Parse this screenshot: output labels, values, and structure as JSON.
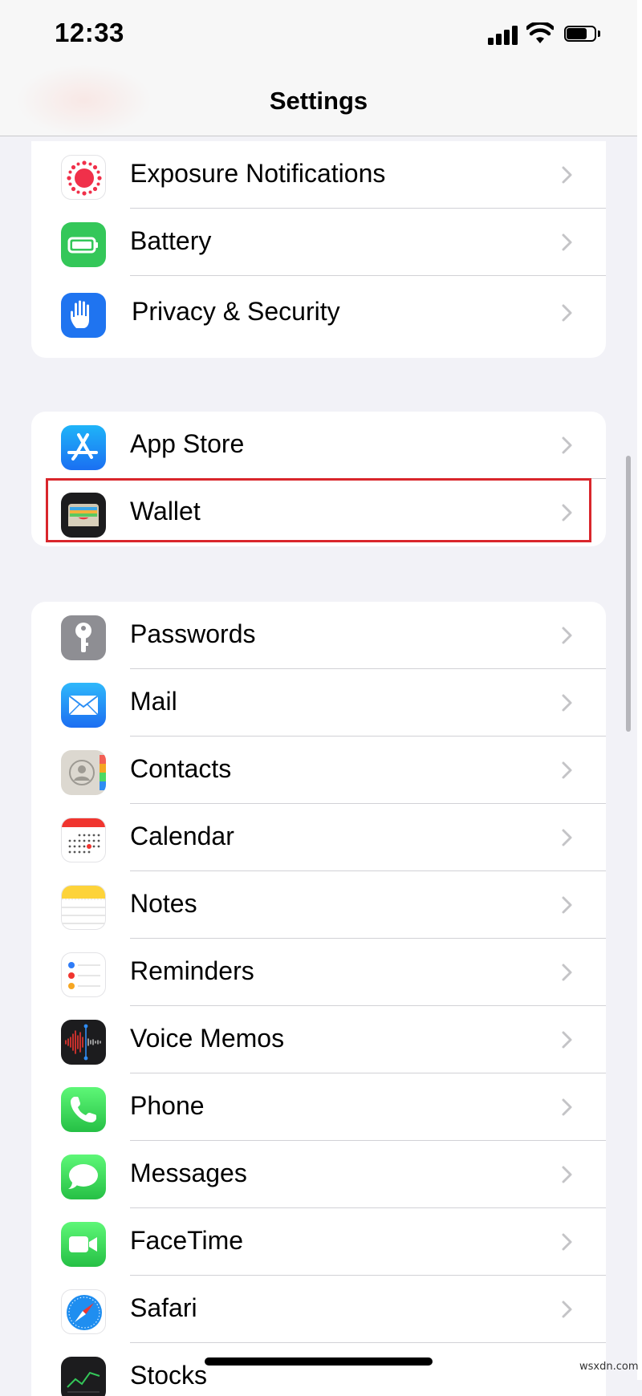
{
  "status_bar": {
    "time": "12:33"
  },
  "nav": {
    "title": "Settings"
  },
  "groups": [
    {
      "items": [
        {
          "label": "Exposure Notifications",
          "icon": "exposure-icon"
        },
        {
          "label": "Battery",
          "icon": "battery-icon"
        },
        {
          "label": "Privacy & Security",
          "icon": "hand-icon"
        }
      ]
    },
    {
      "items": [
        {
          "label": "App Store",
          "icon": "app-store-icon"
        },
        {
          "label": "Wallet",
          "icon": "wallet-icon",
          "highlighted": true
        }
      ]
    },
    {
      "items": [
        {
          "label": "Passwords",
          "icon": "key-icon"
        },
        {
          "label": "Mail",
          "icon": "mail-icon"
        },
        {
          "label": "Contacts",
          "icon": "contacts-icon"
        },
        {
          "label": "Calendar",
          "icon": "calendar-icon"
        },
        {
          "label": "Notes",
          "icon": "notes-icon"
        },
        {
          "label": "Reminders",
          "icon": "reminders-icon"
        },
        {
          "label": "Voice Memos",
          "icon": "voice-memos-icon"
        },
        {
          "label": "Phone",
          "icon": "phone-icon"
        },
        {
          "label": "Messages",
          "icon": "messages-icon"
        },
        {
          "label": "FaceTime",
          "icon": "facetime-icon"
        },
        {
          "label": "Safari",
          "icon": "safari-icon"
        },
        {
          "label": "Stocks",
          "icon": "stocks-icon"
        }
      ]
    }
  ],
  "colors": {
    "highlight": "#d9262c",
    "background": "#f2f2f7",
    "chevron": "#c4c4c7"
  },
  "watermark": "wsxdn.com"
}
